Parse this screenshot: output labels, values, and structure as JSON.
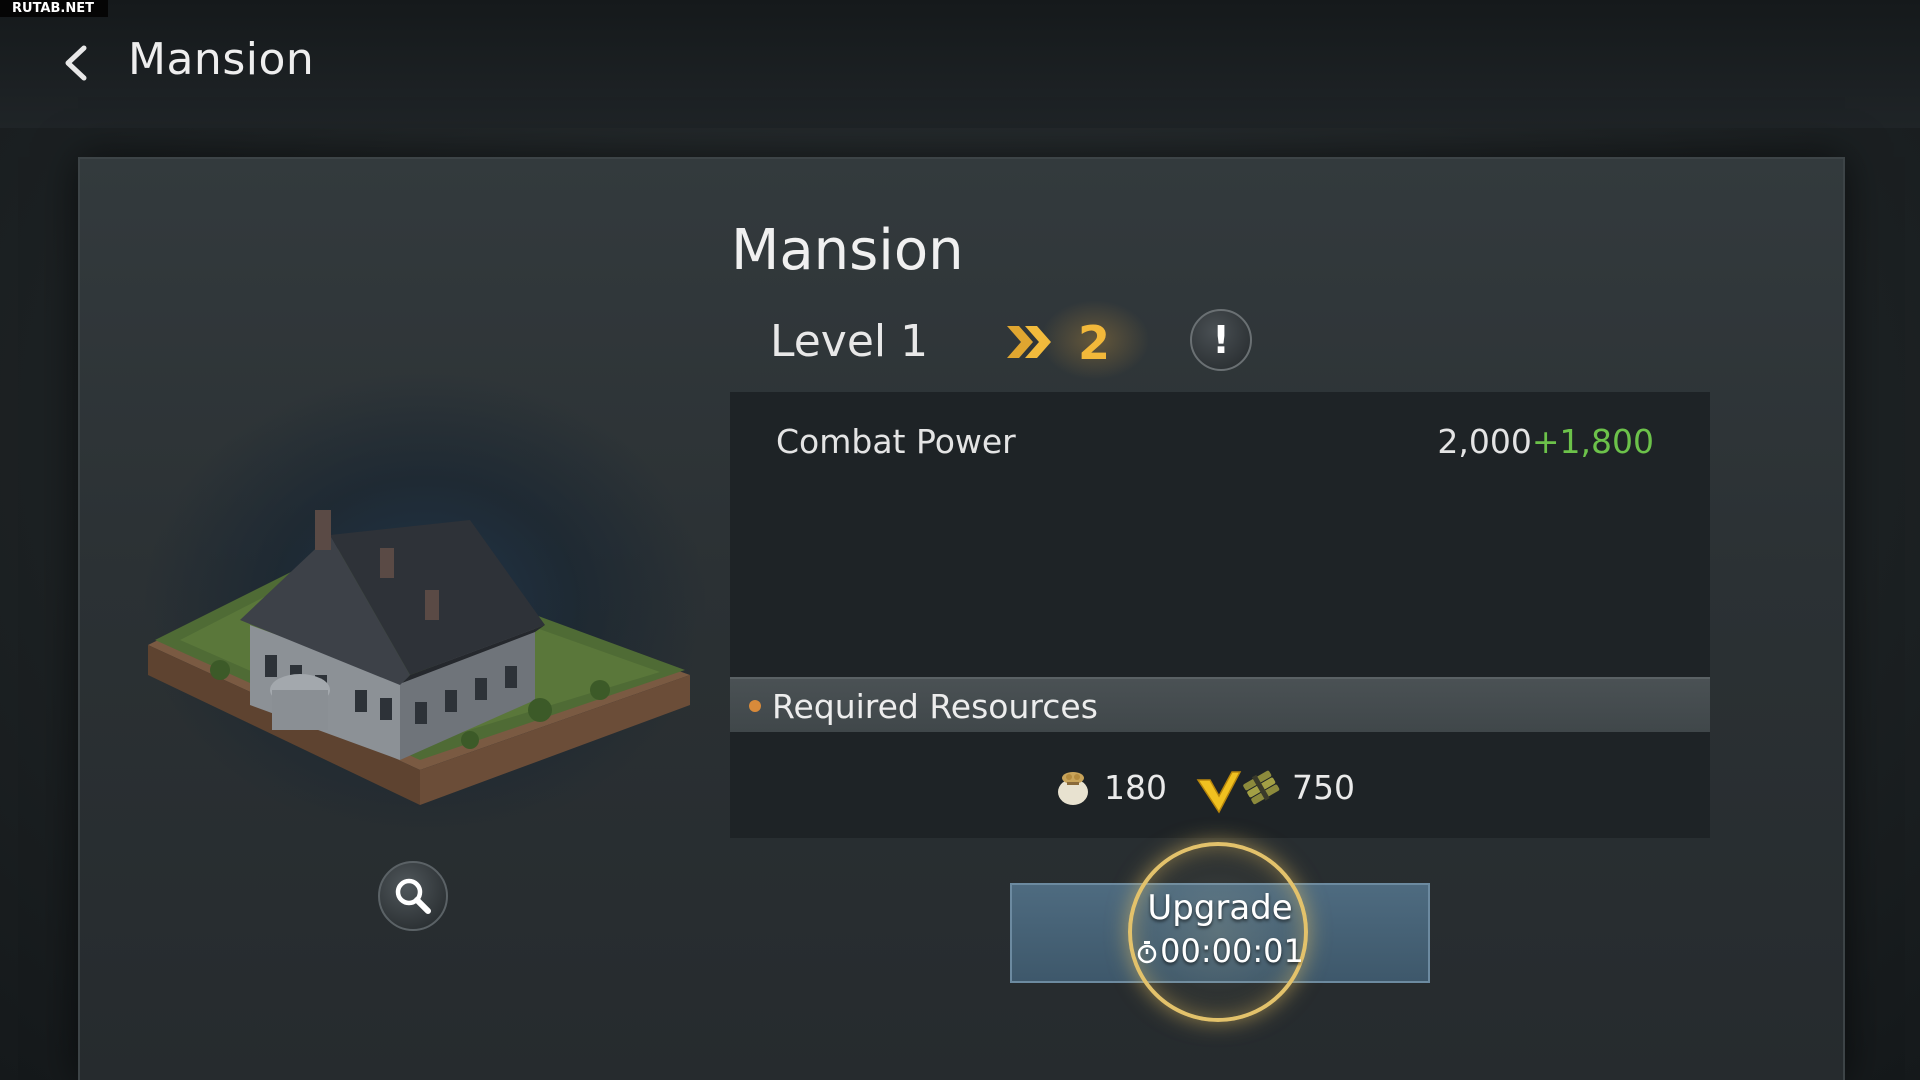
{
  "watermark": "RUTAB.NET",
  "header": {
    "title": "Mansion",
    "back_icon": "chevron-left-icon"
  },
  "building": {
    "name": "Mansion",
    "image": "mansion-building-illustration",
    "zoom_icon": "magnifier-icon"
  },
  "level": {
    "current": "Level 1",
    "next": "2",
    "arrow_icon": "double-chevron-right-icon",
    "info_label": "!"
  },
  "stats": [
    {
      "label": "Combat Power",
      "current": "2,000",
      "increase": "+1,800"
    }
  ],
  "requirements": {
    "title": "Required Resources",
    "items": [
      {
        "icon": "food-sack-icon",
        "value": "180"
      },
      {
        "icon": "wood-bundle-icon",
        "value": "750"
      }
    ],
    "tutorial_pointer": "yellow-check-arrow-icon"
  },
  "upgrade": {
    "label": "Upgrade",
    "time": "00:00:01",
    "timer_icon": "stopwatch-icon"
  },
  "colors": {
    "increase": "#6cc24a",
    "next_level": "#f2b83a",
    "button": "#4e6b80",
    "highlight_ring": "#e3c26b",
    "req_dot": "#d88a3a"
  }
}
